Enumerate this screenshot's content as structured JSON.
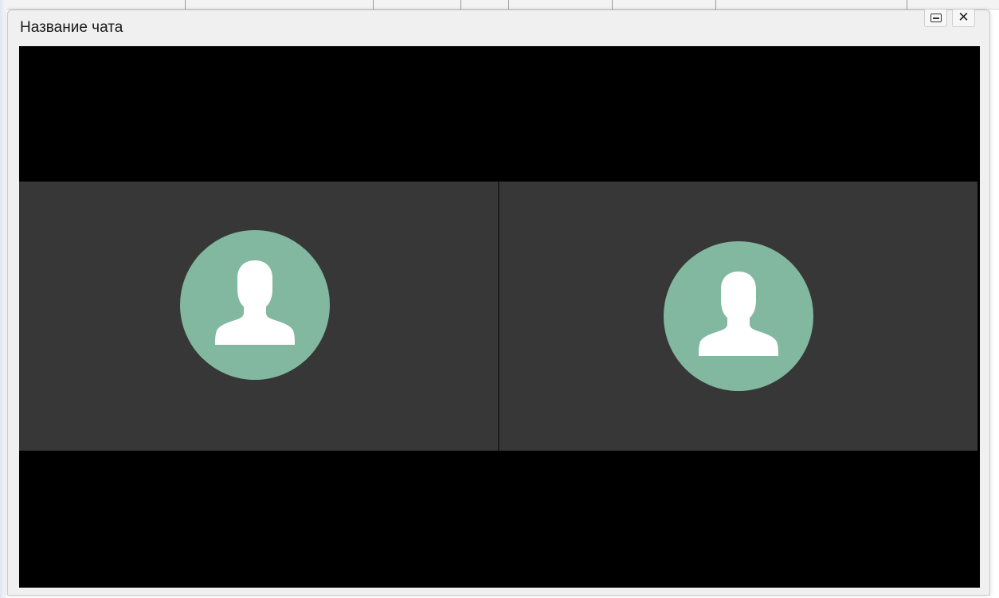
{
  "dialog": {
    "title": "Название чата",
    "minimize_icon": "minimize-icon",
    "close_label": "✕"
  },
  "participants": [
    {
      "icon": "user-avatar-icon"
    },
    {
      "icon": "user-avatar-icon"
    }
  ],
  "colors": {
    "dialog_bg": "#f0f0f0",
    "video_bg": "#000000",
    "tile_bg": "#383737",
    "avatar_bg": "#82b7a0",
    "avatar_fg": "#ffffff"
  }
}
